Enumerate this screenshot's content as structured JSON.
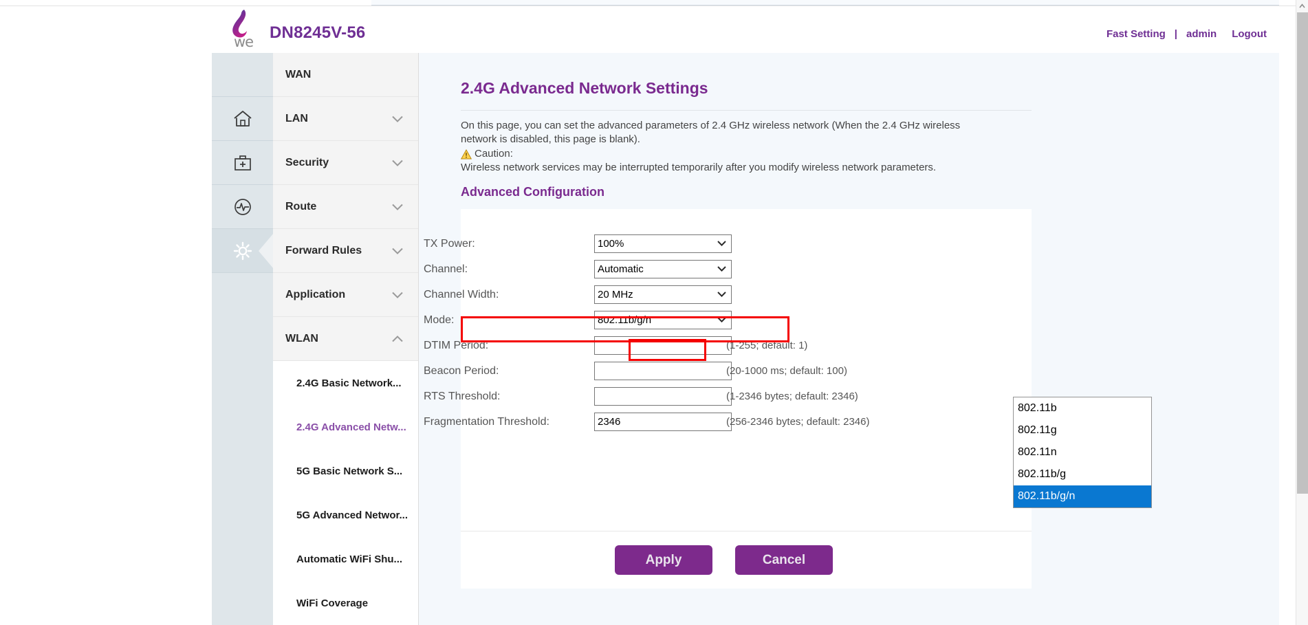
{
  "header": {
    "brand_title": "DN8245V-56",
    "logo_word": "we",
    "nav": {
      "fast_setting": "Fast Setting",
      "separator": "|",
      "user": "admin",
      "logout": "Logout"
    }
  },
  "icon_rail": [
    {
      "name": "blank",
      "icon": ""
    },
    {
      "name": "home-icon",
      "icon": "home"
    },
    {
      "name": "firstaid-icon",
      "icon": "first-aid-kit"
    },
    {
      "name": "diagnostics-icon",
      "icon": "pulse-circle"
    },
    {
      "name": "settings-icon",
      "icon": "gear",
      "active": true
    }
  ],
  "menu": {
    "items": [
      {
        "label": "WAN",
        "chevron": "none"
      },
      {
        "label": "LAN",
        "chevron": "down"
      },
      {
        "label": "Security",
        "chevron": "down"
      },
      {
        "label": "Route",
        "chevron": "down"
      },
      {
        "label": "Forward Rules",
        "chevron": "down"
      },
      {
        "label": "Application",
        "chevron": "down"
      },
      {
        "label": "WLAN",
        "chevron": "up"
      }
    ],
    "submenu": [
      {
        "label": "2.4G Basic Network...",
        "active": false
      },
      {
        "label": "2.4G Advanced Netw...",
        "active": true
      },
      {
        "label": "5G Basic Network S...",
        "active": false
      },
      {
        "label": "5G Advanced Networ...",
        "active": false
      },
      {
        "label": "Automatic WiFi Shu...",
        "active": false
      },
      {
        "label": "WiFi Coverage",
        "active": false
      }
    ]
  },
  "page": {
    "title": "2.4G Advanced Network Settings",
    "description_line1": "On this page, you can set the advanced parameters of 2.4 GHz wireless network (When the 2.4 GHz wireless",
    "description_line2": "network is disabled, this page is blank).",
    "caution_label": "Caution:",
    "caution_text": "Wireless network services may be interrupted temporarily after you modify wireless network parameters.",
    "section_title": "Advanced Configuration"
  },
  "form": {
    "fields": [
      {
        "label": "TX Power:",
        "type": "select",
        "value": "100%",
        "hint": ""
      },
      {
        "label": "Channel:",
        "type": "select",
        "value": "Automatic",
        "hint": ""
      },
      {
        "label": "Channel Width:",
        "type": "select",
        "value": "20 MHz",
        "hint": ""
      },
      {
        "label": "Mode:",
        "type": "select",
        "value": "802.11b/g/n",
        "hint": "",
        "highlighted": true
      },
      {
        "label": "DTIM Period:",
        "type": "text",
        "value": "",
        "hint": "(1-255; default: 1)"
      },
      {
        "label": "Beacon Period:",
        "type": "text",
        "value": "",
        "hint": "(20-1000 ms; default: 100)"
      },
      {
        "label": "RTS Threshold:",
        "type": "text",
        "value": "",
        "hint": "(1-2346 bytes; default: 2346)"
      },
      {
        "label": "Fragmentation Threshold:",
        "type": "text",
        "value": "2346",
        "hint": "(256-2346 bytes; default: 2346)"
      }
    ],
    "mode_dropdown": {
      "open": true,
      "options": [
        "802.11b",
        "802.11g",
        "802.11n",
        "802.11b/g",
        "802.11b/g/n"
      ],
      "selected": "802.11b/g/n",
      "highlight_color": "#0a78d1"
    },
    "buttons": {
      "apply": "Apply",
      "cancel": "Cancel"
    }
  },
  "colors": {
    "brand_purple": "#6f2f94",
    "title_purple": "#7a2a8f",
    "button_purple": "#7d2a8c",
    "annotation_red": "#f40000",
    "select_highlight": "#0a78d1",
    "rail_bg": "#dfe6ea",
    "menu_bg": "#f4f4f4",
    "content_bg": "#f4f8fc"
  }
}
